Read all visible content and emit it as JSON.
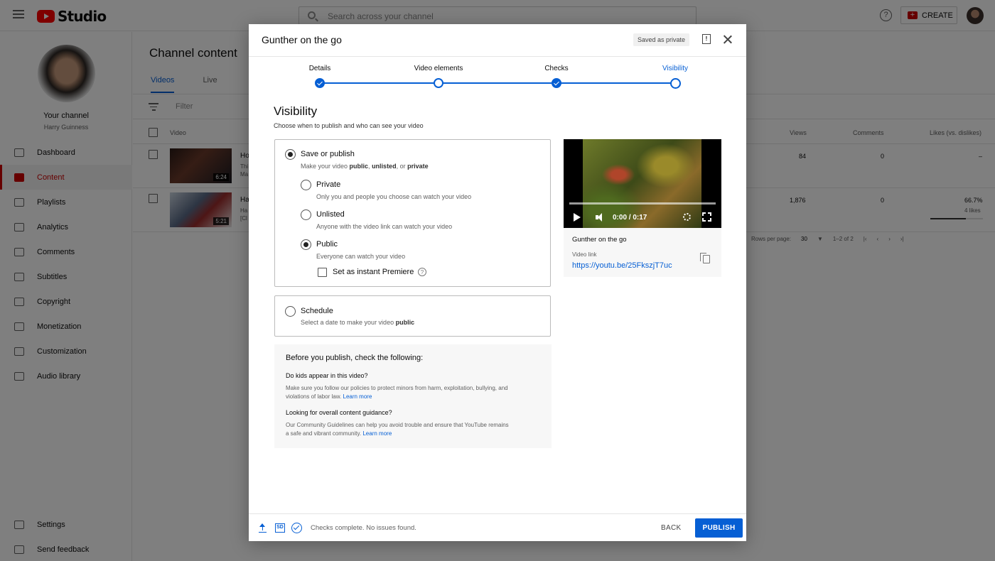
{
  "app": {
    "logo_text": "Studio",
    "search_placeholder": "Search across your channel",
    "create_label": "CREATE",
    "brand_color": "#ff0000",
    "accent_color": "#065fd4"
  },
  "sidebar": {
    "channel_title": "Your channel",
    "channel_owner": "Harry Guinness",
    "items": [
      {
        "label": "Dashboard",
        "icon": "dashboard-icon"
      },
      {
        "label": "Content",
        "icon": "content-icon",
        "active": true
      },
      {
        "label": "Playlists",
        "icon": "playlists-icon"
      },
      {
        "label": "Analytics",
        "icon": "analytics-icon"
      },
      {
        "label": "Comments",
        "icon": "comments-icon"
      },
      {
        "label": "Subtitles",
        "icon": "subtitles-icon"
      },
      {
        "label": "Copyright",
        "icon": "copyright-icon"
      },
      {
        "label": "Monetization",
        "icon": "monetization-icon"
      },
      {
        "label": "Customization",
        "icon": "customization-icon"
      },
      {
        "label": "Audio library",
        "icon": "audio-library-icon"
      }
    ],
    "bottom": [
      {
        "label": "Settings",
        "icon": "gear-icon"
      },
      {
        "label": "Send feedback",
        "icon": "feedback-icon"
      }
    ]
  },
  "content": {
    "title": "Channel content",
    "tabs": [
      "Videos",
      "Live"
    ],
    "filter_placeholder": "Filter",
    "columns": {
      "video": "Video",
      "views": "Views",
      "comments": "Comments",
      "likes": "Likes (vs. dislikes)"
    },
    "rows": [
      {
        "title_fragment": "Ho",
        "desc_1": "Thi",
        "desc_2": "Ma",
        "duration": "6:24",
        "views": "84",
        "comments": "0",
        "likes": "–",
        "likes_count": ""
      },
      {
        "title_fragment": "Ha",
        "desc_1": "Ha",
        "desc_2": "[Cl",
        "duration": "5:21",
        "views": "1,876",
        "comments": "0",
        "likes": "66.7%",
        "likes_count": "4 likes"
      }
    ],
    "pager": {
      "rows_per_page_label": "Rows per page:",
      "rows_per_page": "30",
      "range": "1–2 of 2"
    }
  },
  "dialog": {
    "title": "Gunther on the go",
    "saved_status": "Saved as private",
    "steps": [
      {
        "label": "Details",
        "state": "done"
      },
      {
        "label": "Video elements",
        "state": "visited"
      },
      {
        "label": "Checks",
        "state": "done"
      },
      {
        "label": "Visibility",
        "state": "current"
      }
    ],
    "visibility_title": "Visibility",
    "visibility_subtitle": "Choose when to publish and who can see your video",
    "save_or_publish": {
      "label": "Save or publish",
      "sub_prefix": "Make your video ",
      "sub_public": "public",
      "sub_sep1": ", ",
      "sub_unlisted": "unlisted",
      "sub_sep2": ", or ",
      "sub_private": "private"
    },
    "options": [
      {
        "label": "Private",
        "sub": "Only you and people you choose can watch your video"
      },
      {
        "label": "Unlisted",
        "sub": "Anyone with the video link can watch your video"
      },
      {
        "label": "Public",
        "sub": "Everyone can watch your video"
      }
    ],
    "selected_option": "Public",
    "premiere_label": "Set as instant Premiere",
    "premiere_help": "?",
    "schedule": {
      "label": "Schedule",
      "sub_prefix": "Select a date to make your video ",
      "sub_bold": "public"
    },
    "guidance": {
      "heading": "Before you publish, check the following:",
      "q1": "Do kids appear in this video?",
      "p1": "Make sure you follow our policies to protect minors from harm, exploitation, bullying, and violations of labor law. ",
      "q2": "Looking for overall content guidance?",
      "p2": "Our Community Guidelines can help you avoid trouble and ensure that YouTube remains a safe and vibrant community. ",
      "learn_more": "Learn more"
    },
    "preview": {
      "time": "0:00 / 0:17",
      "title": "Gunther on the go",
      "link_label": "Video link",
      "link": "https://youtu.be/25FkszjT7uc"
    },
    "footer": {
      "sd_label": "SD",
      "status": "Checks complete. No issues found.",
      "back_label": "BACK",
      "publish_label": "PUBLISH"
    }
  }
}
